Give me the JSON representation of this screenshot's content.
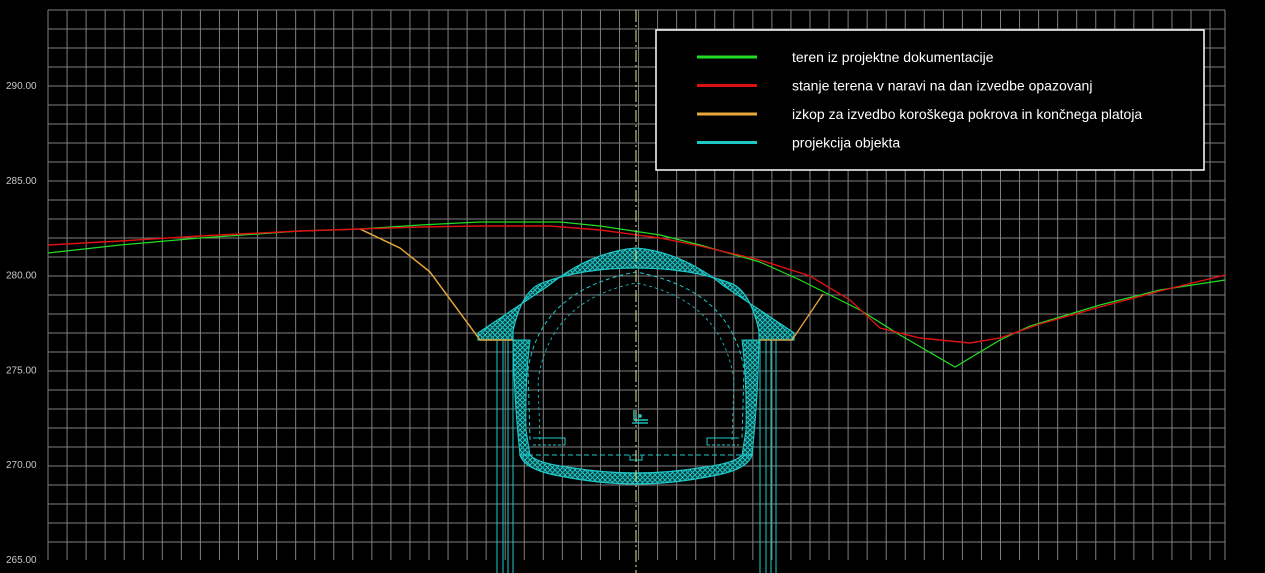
{
  "colors": {
    "background": "#000000",
    "grid": "#7f7f7f",
    "teren_projekt": "#22dd22",
    "teren_narava": "#dd1111",
    "izkop": "#e8a93a",
    "objekt": "#1ec8c8",
    "axis": "#e8e88a"
  },
  "y_axis": {
    "ticks": [
      {
        "value": 290,
        "label": "290.00"
      },
      {
        "value": 285,
        "label": "285.00"
      },
      {
        "value": 280,
        "label": "280.00"
      },
      {
        "value": 275,
        "label": "275.00"
      },
      {
        "value": 270,
        "label": "270.00"
      },
      {
        "value": 265,
        "label": "265.00"
      }
    ]
  },
  "legend": {
    "items": [
      {
        "key": "teren_projekt",
        "label": "teren iz projektne dokumentacije",
        "color": "#22dd22"
      },
      {
        "key": "teren_narava",
        "label": "stanje terena v naravi na dan izvedbe opazovanj",
        "color": "#dd1111"
      },
      {
        "key": "izkop",
        "label": "izkop za izvedbo koroškega pokrova in končnega platoja",
        "color": "#e8a93a"
      },
      {
        "key": "objekt",
        "label": "projekcija objekta",
        "color": "#1ec8c8"
      }
    ]
  }
}
